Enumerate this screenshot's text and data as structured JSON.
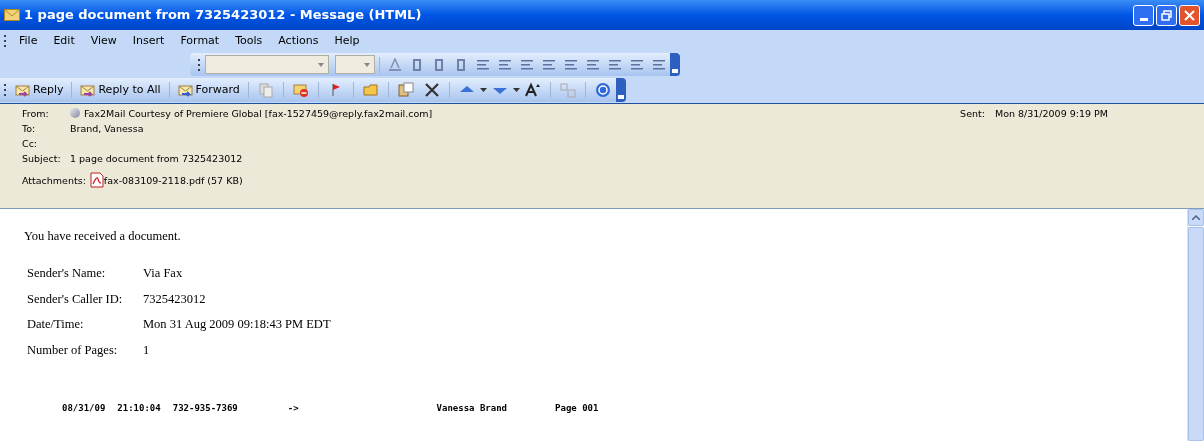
{
  "window": {
    "title": "1 page document from 7325423012 - Message (HTML)"
  },
  "menu": [
    "File",
    "Edit",
    "View",
    "Insert",
    "Format",
    "Tools",
    "Actions",
    "Help"
  ],
  "toolbar": [
    {
      "kind": "labeled",
      "label": "Reply"
    },
    {
      "kind": "labeled",
      "label": "Reply to All"
    },
    {
      "kind": "labeled",
      "label": "Forward"
    }
  ],
  "header": {
    "fields": [
      {
        "label": "From:",
        "value": "Fax2Mail Courtesy of Premiere Global [fax-1527459@reply.fax2mail.com]",
        "kind": "sender"
      },
      {
        "label": "To:",
        "value": "Brand, Vanessa",
        "kind": "plain"
      },
      {
        "label": "Cc:",
        "kind": "plain"
      },
      {
        "label": "Subject:",
        "value": "1 page document from 7325423012",
        "kind": "plain"
      }
    ],
    "sent": {
      "label": "Sent:",
      "value": "Mon 8/31/2009 9:19 PM"
    },
    "attachments": {
      "label": "Attachments:",
      "file": "fax-083109-2118.pdf (57 KB)"
    }
  },
  "body": {
    "intro": "You have received a document.",
    "details": [
      {
        "label": "Sender's Name:",
        "value": "Via Fax"
      },
      {
        "label": "Sender's Caller ID:",
        "value": "7325423012"
      },
      {
        "label": "Date/Time:",
        "value": "Mon 31 Aug 2009 09:18:43 PM EDT"
      },
      {
        "label": "Number of Pages:",
        "value": "1"
      }
    ],
    "fax_line": [
      "08/31/09",
      "21:10:04",
      "732-935-7369",
      "->",
      "Vanessa Brand",
      "Page 001"
    ]
  }
}
